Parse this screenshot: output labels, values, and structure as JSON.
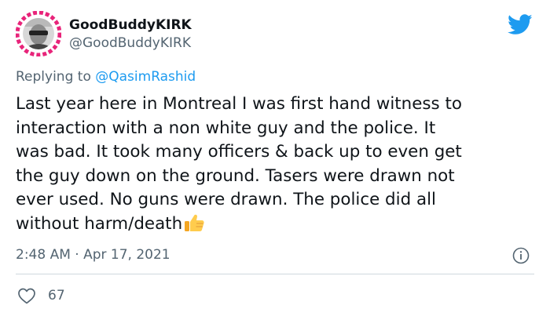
{
  "author": {
    "display_name": "GoodBuddyKIRK",
    "handle": "@GoodBuddyKIRK"
  },
  "reply": {
    "prefix": "Replying to ",
    "mention": "@QasimRashid"
  },
  "tweet": {
    "lines": [
      "Last year here in Montreal I was first hand witness to",
      "interaction with a non white guy and the police. It",
      "was bad. It took many officers & back up to even get",
      "the guy down on the ground. Tasers were drawn not",
      "ever used. No guns were drawn. The police did all",
      "without harm/death"
    ],
    "emoji": "thumbs-up-icon",
    "timestamp": "2:48 AM · Apr 17, 2021"
  },
  "engagement": {
    "likes": "67"
  },
  "colors": {
    "twitter_blue": "#1d9bf0",
    "secondary_text": "#536471",
    "avatar_ring": "#e8247a"
  }
}
